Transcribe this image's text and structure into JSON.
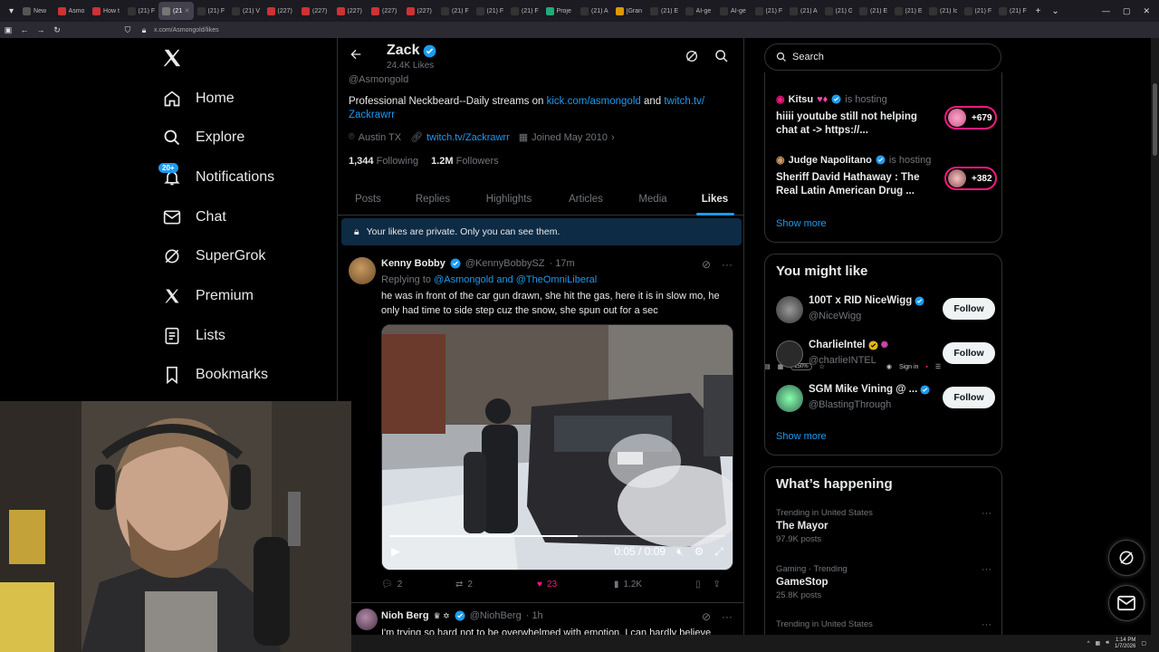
{
  "browser": {
    "tabs": [
      "New",
      "Asmo",
      "How t",
      "(21) F",
      "(21)",
      "(21) F",
      "(21) V",
      "(227)",
      "(227)",
      "(227)",
      "(227)",
      "(227)",
      "(21) F",
      "(21) F",
      "(21) F",
      "Proje",
      "(21) A",
      "[Gran",
      "(21) E",
      "AI-ge",
      "AI-ge",
      "(21) F",
      "(21) A",
      "(21) G",
      "(21) E",
      "(21) E",
      "(21) Ic",
      "(21) F",
      "(21) F"
    ],
    "active_tab": 4,
    "url": "x.com/Asmongold/likes",
    "zoom": "150%",
    "signin": "Sign in"
  },
  "nav": {
    "items": [
      {
        "label": "Home",
        "icon": "home-icon"
      },
      {
        "label": "Explore",
        "icon": "search-icon"
      },
      {
        "label": "Notifications",
        "icon": "bell-icon",
        "badge": "20+"
      },
      {
        "label": "Chat",
        "icon": "mail-icon"
      },
      {
        "label": "SuperGrok",
        "icon": "grok-icon"
      },
      {
        "label": "Premium",
        "icon": "x-logo-icon"
      },
      {
        "label": "Lists",
        "icon": "list-icon"
      },
      {
        "label": "Bookmarks",
        "icon": "bookmark-icon"
      }
    ]
  },
  "profile": {
    "name": "Zack",
    "likes_count": "24.4K Likes",
    "handle": "@Asmongold",
    "bio_text": "Professional Neckbeard--Daily streams on ",
    "bio_link1": "kick.com/asmongold",
    "bio_and": " and ",
    "bio_link2a": "twitch.tv/",
    "bio_link2b": "Zackrawrr",
    "location": "Austin TX",
    "website": "twitch.tv/Zackrawrr",
    "joined": "Joined May 2010",
    "following_count": "1,344",
    "following_label": "Following",
    "followers_count": "1.2M",
    "followers_label": "Followers",
    "tabs": [
      "Posts",
      "Replies",
      "Highlights",
      "Articles",
      "Media",
      "Likes"
    ],
    "active_tab": 5,
    "private_notice": "Your likes are private. Only you can see them."
  },
  "tweets": [
    {
      "name": "Kenny Bobby",
      "handle": "@KennyBobbySZ",
      "time": "· 17m",
      "replying_prefix": "Replying to ",
      "replying_to": "@Asmongold and @TheOmniLiberal",
      "text": "he was in front of the car gun drawn, she hit the gas, here it is in slow mo, he only had time to side step cuz the snow, she spun out for a sec",
      "video_time": "0:05 / 0:09",
      "video_progress": 0.56,
      "replies": "2",
      "reposts": "2",
      "likes": "23",
      "views": "1.2K"
    },
    {
      "name": "Nioh Berg",
      "handle": "@NiohBerg",
      "time": "· 1h",
      "text": "I'm trying so hard not to be overwhelmed with emotion. I can hardly believe"
    }
  ],
  "right": {
    "search_placeholder": "Search",
    "live": [
      {
        "name": "Kitsu",
        "status": "is hosting",
        "title": "hiiii youtube still not helping chat at -> https://...",
        "count": "+679"
      },
      {
        "name": "Judge Napolitano",
        "status": "is hosting",
        "title": "Sheriff David Hathaway : The Real Latin American Drug ...",
        "count": "+382"
      }
    ],
    "show_more": "Show more",
    "wtf_title": "You might like",
    "wtf": [
      {
        "name": "100T x RID NiceWigg",
        "handle": "@NiceWigg",
        "follow": "Follow"
      },
      {
        "name": "CharlieIntel",
        "handle": "@charlieINTEL",
        "follow": "Follow"
      },
      {
        "name": "SGM Mike Vining @ ...",
        "handle": "@BlastingThrough",
        "follow": "Follow"
      }
    ],
    "trends_title": "What’s happening",
    "trends": [
      {
        "context": "Trending in United States",
        "title": "The Mayor",
        "count": "97.9K posts"
      },
      {
        "context": "Gaming · Trending",
        "title": "GameStop",
        "count": "25.8K posts"
      },
      {
        "context": "Trending in United States",
        "title": "",
        "count": ""
      }
    ]
  },
  "taskbar": {
    "time": "1:14 PM",
    "date": "1/7/2026"
  },
  "colors": {
    "accent": "#1d9bf0",
    "like": "#f91880",
    "bg": "#000000",
    "border": "#2f3336",
    "muted": "#71767b"
  }
}
